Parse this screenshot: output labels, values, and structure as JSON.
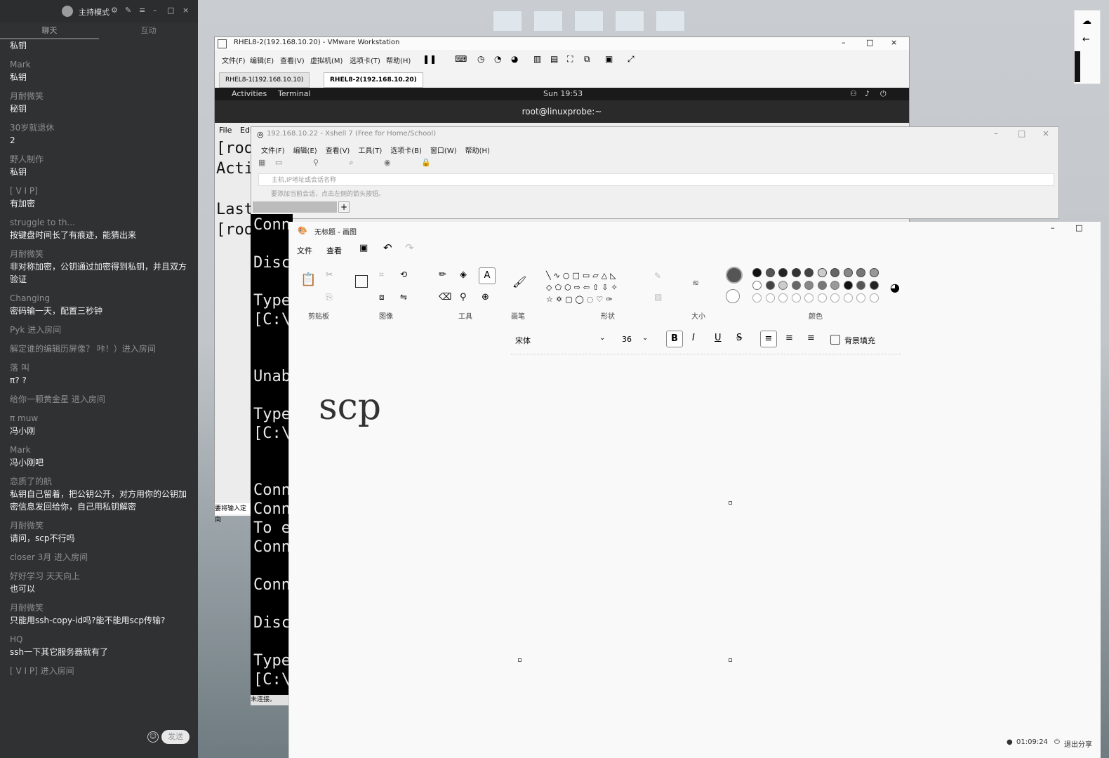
{
  "chat": {
    "host_mode": "主持模式",
    "tabs": [
      "聊天",
      "互动"
    ],
    "messages": [
      {
        "name": "",
        "text": "私钥"
      },
      {
        "name": "Mark",
        "text": "私钥"
      },
      {
        "name": "月耐微笑",
        "text": "秘钥"
      },
      {
        "name": "30岁就退休",
        "text": "2"
      },
      {
        "name": "野人制作",
        "text": "私钥"
      },
      {
        "name": "[ V I P]",
        "text": "有加密"
      },
      {
        "name": "struggle to th...",
        "text": "按键盘时间长了有痕迹，能猜出来"
      },
      {
        "name": "月耐微笑",
        "text": "非对称加密，公钥通过加密得到私钥，并且双方验证"
      },
      {
        "name": "Changing",
        "text": "密码输一天，配置三秒钟"
      },
      {
        "sys": "Pyk 进入房间"
      },
      {
        "sys": "解定谁的编辑历屏像？ 咔！）进入房间"
      },
      {
        "name": "落 叫",
        "text": "π? ?"
      },
      {
        "sys": "给你一颗黄金星 进入房间"
      },
      {
        "name": "π muw",
        "text": "冯小刚"
      },
      {
        "name": "Mark",
        "text": "冯小刚吧"
      },
      {
        "name": "恋质了的航",
        "text": "私钥自己留着，把公钥公开，对方用你的公钥加密信息发回给你，自己用私钥解密"
      },
      {
        "name": "月耐微笑",
        "text": "请问，scp不行吗"
      },
      {
        "sys": "closer 3月 进入房间"
      },
      {
        "name": "好好学习 天天向上",
        "text": "也可以"
      },
      {
        "name": "月耐微笑",
        "text": "只能用ssh-copy-id吗?能不能用scp传输?"
      },
      {
        "name": "HQ",
        "text": "ssh一下其它服务器就有了"
      },
      {
        "sys": "[ V I P] 进入房间"
      }
    ],
    "send_label": "发送"
  },
  "vmware": {
    "title": "RHEL8-2(192.168.10.20) - VMware Workstation",
    "menu": [
      "文件(F)",
      "编辑(E)",
      "查看(V)",
      "虚拟机(M)",
      "选项卡(T)",
      "帮助(H)"
    ],
    "tabs": [
      "RHEL8-1(192.168.10.10)",
      "RHEL8-2(192.168.10.20)"
    ],
    "activities": "Activities",
    "terminal": "Terminal",
    "clock": "Sun 19:53",
    "term_title": "root@linuxprobe:~",
    "term_menu": [
      "File",
      "Edi"
    ],
    "term_lines": [
      "[roo",
      "Acti",
      "",
      "Last",
      "[roo"
    ],
    "status_text": "要将输入定向"
  },
  "xshell": {
    "title": "192.168.10.22 - Xshell 7 (Free for Home/School)",
    "menu": [
      "文件(F)",
      "编辑(E)",
      "查看(V)",
      "工具(T)",
      "选项卡(B)",
      "窗口(W)",
      "帮助(H)"
    ],
    "address_placeholder": "主机,IP地址或会话名称",
    "hint": "要添加当前会话，点击左侧的箭头按钮。",
    "term_lines": [
      "Conn",
      "",
      "Disc",
      "",
      "Type",
      "[C:\\",
      "",
      "",
      "Unab",
      "",
      "Type",
      "[C:\\",
      "",
      "",
      "Conn",
      "Conn",
      "To e",
      "Conn",
      "",
      "Conn",
      "",
      "Disc",
      "",
      "Type",
      "[C:\\"
    ],
    "status": "未连接。"
  },
  "paint": {
    "title": "无标题 - 画图",
    "menu": [
      "文件",
      "查看"
    ],
    "groups": [
      "剪贴板",
      "图像",
      "工具",
      "画笔",
      "形状",
      "大小",
      "颜色"
    ],
    "font_name": "宋体",
    "font_size": "36",
    "bg_fill_label": "背景填充",
    "canvas_text": "scp"
  },
  "statusbar": {
    "time": "01:09:24",
    "exit_share": "退出分享"
  }
}
